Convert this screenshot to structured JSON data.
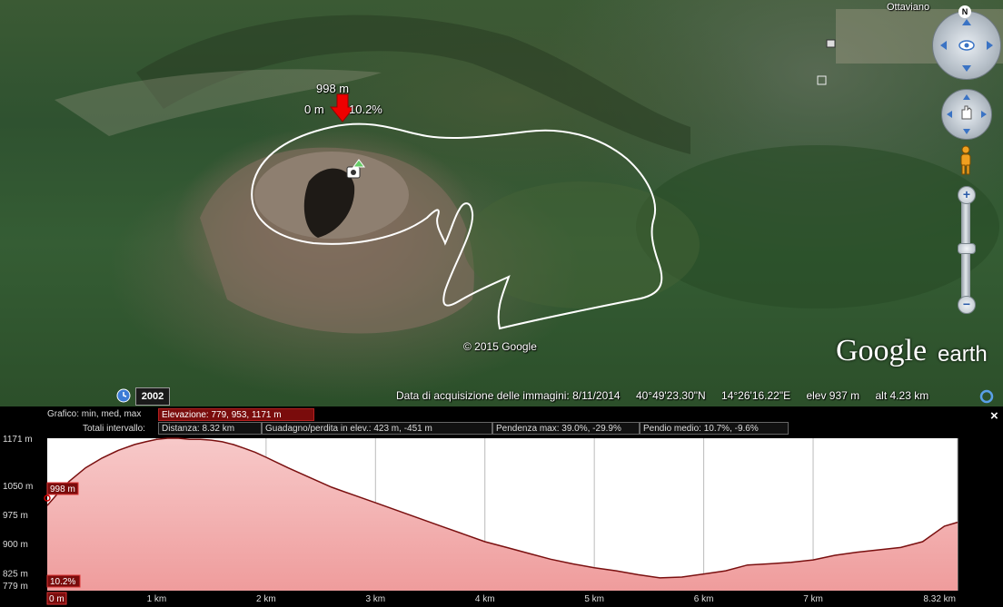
{
  "map": {
    "town_label": "Ottaviano",
    "copyright": "© 2015 Google",
    "logo": {
      "google": "Google",
      "earth": "earth"
    },
    "north_label": "N",
    "marker": {
      "elevation": "998 m",
      "distance": "0 m",
      "slope": "10.2%"
    },
    "historical_year": "2002",
    "status": {
      "imagery_date": "Data di acquisizione delle immagini: 8/11/2014",
      "lat": "40°49'23.30\"N",
      "lon": "14°26'16.22\"E",
      "elev": "elev   937 m",
      "alt": "alt   4.23 km"
    },
    "icons": [
      "clock-icon",
      "camera-icon",
      "pegman-icon",
      "look-joystick-icon",
      "move-joystick-icon",
      "zoom-in-icon",
      "zoom-out-icon",
      "loading-ring-icon"
    ]
  },
  "profile": {
    "row1_label": "Grafico: min, med, max",
    "elevation_summary": "Elevazione: 779, 953, 1171 m",
    "row2_label": "Totali intervallo:",
    "distance": "Distanza: 8.32 km",
    "gain_loss": "Guadagno/perdita in elev.: 423 m, -451 m",
    "max_slope": "Pendenza max: 39.0%, -29.9%",
    "avg_slope": "Pendio medio: 10.7%, -9.6%",
    "close_label": "×",
    "cursor": {
      "elevation_label": "998 m",
      "slope_label": "10.2%",
      "distance_label": "0 m"
    }
  },
  "chart_data": {
    "type": "area",
    "x_unit": "km",
    "y_unit": "m",
    "xlim": [
      0,
      8.32
    ],
    "ylim": [
      779,
      1171
    ],
    "y_ticks": [
      {
        "value": 1171,
        "label": "1171 m"
      },
      {
        "value": 1050,
        "label": "1050 m"
      },
      {
        "value": 975,
        "label": "975 m"
      },
      {
        "value": 900,
        "label": "900 m"
      },
      {
        "value": 825,
        "label": "825 m"
      },
      {
        "value": 779,
        "label": "779 m"
      }
    ],
    "x_ticks": [
      {
        "value": 1,
        "label": "1 km"
      },
      {
        "value": 2,
        "label": "2 km"
      },
      {
        "value": 3,
        "label": "3 km"
      },
      {
        "value": 4,
        "label": "4 km"
      },
      {
        "value": 5,
        "label": "5 km"
      },
      {
        "value": 6,
        "label": "6 km"
      },
      {
        "value": 7,
        "label": "7 km"
      },
      {
        "value": 8.32,
        "label": "8.32 km"
      }
    ],
    "x": [
      0,
      0.1,
      0.2,
      0.35,
      0.5,
      0.65,
      0.8,
      0.9,
      1.0,
      1.1,
      1.2,
      1.3,
      1.4,
      1.5,
      1.6,
      1.7,
      1.8,
      1.9,
      2.0,
      2.2,
      2.4,
      2.6,
      2.8,
      3.0,
      3.2,
      3.4,
      3.6,
      3.8,
      4.0,
      4.2,
      4.4,
      4.6,
      4.8,
      5.0,
      5.2,
      5.4,
      5.6,
      5.8,
      6.0,
      6.2,
      6.4,
      6.6,
      6.8,
      7.0,
      7.2,
      7.4,
      7.6,
      7.8,
      8.0,
      8.2,
      8.32
    ],
    "y": [
      998,
      1030,
      1060,
      1095,
      1120,
      1140,
      1155,
      1162,
      1168,
      1171,
      1171,
      1168,
      1168,
      1166,
      1162,
      1155,
      1145,
      1135,
      1122,
      1095,
      1070,
      1045,
      1025,
      1005,
      985,
      965,
      945,
      925,
      905,
      890,
      875,
      860,
      848,
      838,
      830,
      820,
      812,
      814,
      822,
      830,
      845,
      848,
      852,
      858,
      870,
      878,
      884,
      890,
      905,
      945,
      955
    ],
    "grid": true
  }
}
